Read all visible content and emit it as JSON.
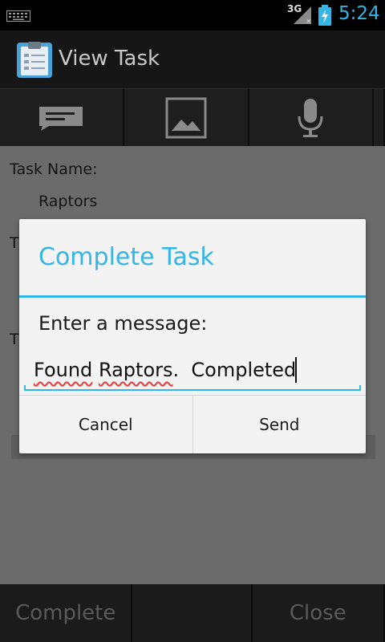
{
  "status_bar": {
    "network_label": "3G",
    "time": "5:24",
    "icons": [
      "keyboard-icon",
      "signal-icon",
      "battery-charging-icon"
    ]
  },
  "action_bar": {
    "title": "View Task",
    "icon": "clipboard-icon"
  },
  "tabs": [
    {
      "icon": "message-icon"
    },
    {
      "icon": "image-icon"
    },
    {
      "icon": "microphone-icon"
    }
  ],
  "task": {
    "name_label": "Task Name:",
    "name_value": "Raptors",
    "second_label": "T",
    "third_label": "T"
  },
  "dialog": {
    "title": "Complete Task",
    "prompt": "Enter a message:",
    "input_word1": "Found",
    "input_word2": "Raptors",
    "input_rest": ".  Completed",
    "cancel_label": "Cancel",
    "send_label": "Send"
  },
  "bottom_bar": {
    "complete_label": "Complete",
    "close_label": "Close"
  },
  "colors": {
    "accent": "#33b5e5",
    "dim_background": "#6b6b6b",
    "spellcheck": "#e23b3b"
  }
}
